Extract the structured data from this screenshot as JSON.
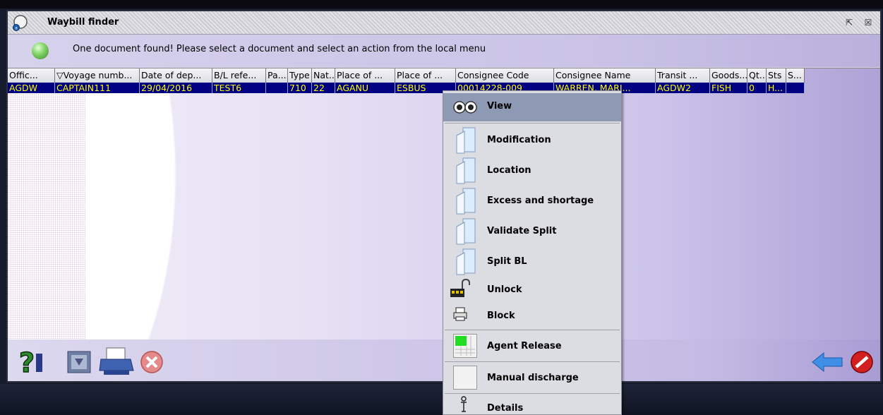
{
  "window": {
    "title": "Waybill finder",
    "minimize_glyph": "⇱",
    "close_glyph": "☒"
  },
  "message": "One document found! Please select a document and select an action from the local menu",
  "columns": [
    "Offic...",
    "▽Voyage numb...",
    "Date of dep...",
    "B/L refe...",
    "Pa...",
    "Type",
    "Nat...",
    "Place of ...",
    "Place of ...",
    "Consignee Code",
    "Consignee Name",
    "Transit ...",
    "Goods...",
    "Qt...",
    "Sts",
    "S..."
  ],
  "row": [
    "AGDW",
    "CAPTAIN111",
    "29/04/2016",
    "TEST6",
    "",
    "710",
    "22",
    "AGANU",
    "ESBUS",
    "00014228-009",
    "WARREN, MARI...",
    "AGDW2",
    "FISH",
    "0",
    "H...",
    ""
  ],
  "context_menu": {
    "items": [
      {
        "label": "View",
        "icon": "eyes-icon",
        "selected": true
      },
      {
        "label": "Modification",
        "icon": "folder-icon"
      },
      {
        "label": "Location",
        "icon": "folder-icon"
      },
      {
        "label": "Excess and shortage",
        "icon": "folder-icon"
      },
      {
        "label": "Validate Split",
        "icon": "folder-icon"
      },
      {
        "label": "Split BL",
        "icon": "folder-icon"
      },
      {
        "label": "Unlock",
        "icon": "padlock-open-icon"
      },
      {
        "label": "Block",
        "icon": "printer-block-icon"
      },
      {
        "label": "Agent Release",
        "icon": "green-grid-icon"
      },
      {
        "label": "Manual discharge",
        "icon": "blank-square-icon"
      },
      {
        "label": "Details",
        "icon": "pin-icon"
      }
    ]
  },
  "toolbar": {
    "left_buttons": [
      "help-icon",
      "export-icon",
      "print-icon",
      "cancel-icon"
    ],
    "right_buttons": [
      "back-arrow-icon",
      "stop-icon"
    ]
  },
  "colors": {
    "selection_bg": "#000080",
    "selection_fg": "#ffff00",
    "menu_highlight": "#8e9ab4"
  }
}
